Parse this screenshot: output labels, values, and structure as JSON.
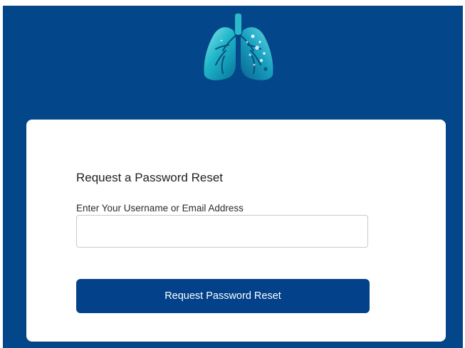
{
  "brand": {
    "logo_icon": "lungs-icon",
    "background_color": "#03478a",
    "button_color": "#03428a"
  },
  "reset_form": {
    "title": "Request a Password Reset",
    "field_label": "Enter Your Username or Email Address",
    "field_value": "",
    "field_placeholder": "",
    "submit_label": "Request Password Reset"
  }
}
